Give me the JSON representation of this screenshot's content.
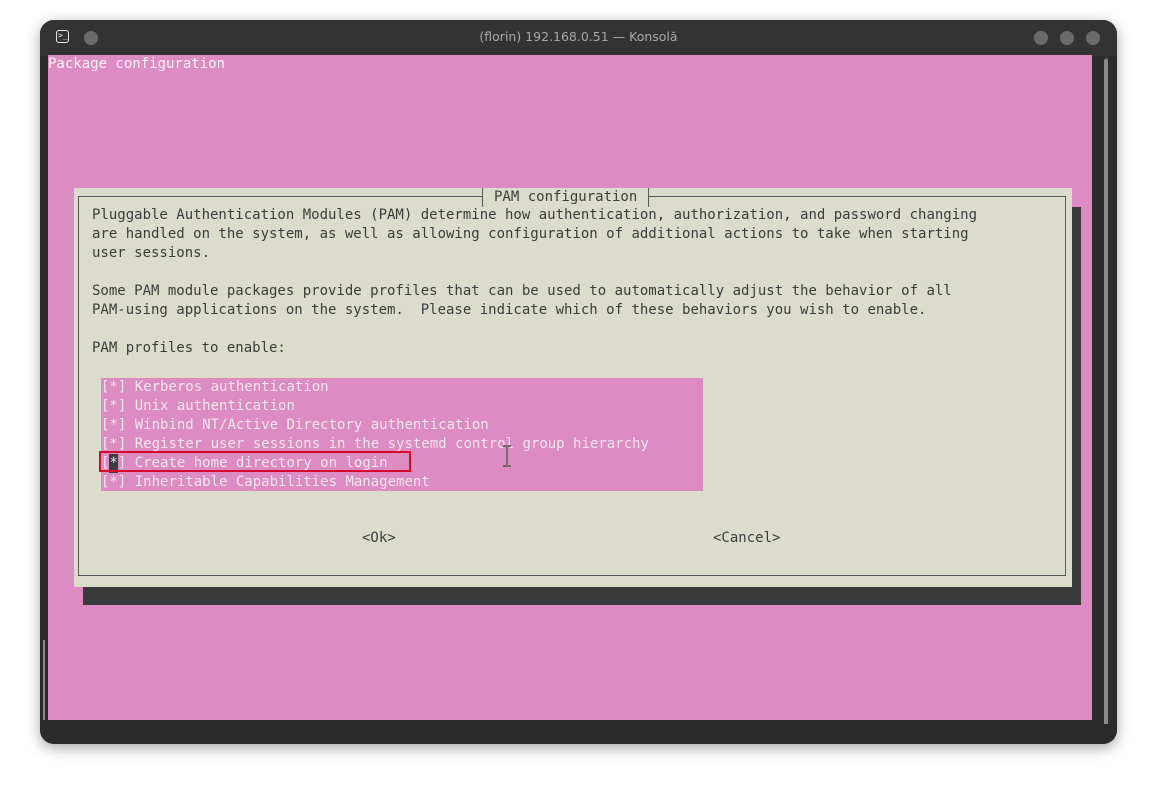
{
  "window": {
    "title": "(florin) 192.168.0.51 — Konsolă",
    "app_icon_glyph": ">_",
    "icons": [
      "terminal-app-icon",
      "pin-icon",
      "minimize-icon",
      "maximize-icon",
      "close-icon"
    ]
  },
  "terminal": {
    "header_line": "Package configuration",
    "background": "#dc8cc3"
  },
  "dialog": {
    "title": "PAM configuration",
    "description": [
      "Pluggable Authentication Modules (PAM) determine how authentication, authorization, and password changing",
      "are handled on the system, as well as allowing configuration of additional actions to take when starting",
      "user sessions.",
      "",
      "Some PAM module packages provide profiles that can be used to automatically adjust the behavior of all",
      "PAM-using applications on the system.  Please indicate which of these behaviors you wish to enable.",
      "",
      "PAM profiles to enable:"
    ],
    "options": [
      {
        "mark": "[*]",
        "label": "Kerberos authentication"
      },
      {
        "mark": "[*]",
        "label": "Unix authentication"
      },
      {
        "mark": "[*]",
        "label": "Winbind NT/Active Directory authentication"
      },
      {
        "mark": "[*]",
        "label": "Register user sessions in the systemd control group hierarchy"
      },
      {
        "mark_open": "[",
        "mark_cursor": "*",
        "mark_close": "]",
        "label": "Create home directory on login"
      },
      {
        "mark": "[*]",
        "label": "Inheritable Capabilities Management"
      }
    ],
    "ok_button": "<Ok>",
    "cancel_button": "<Cancel>",
    "highlight_color": "#d40b2c"
  }
}
